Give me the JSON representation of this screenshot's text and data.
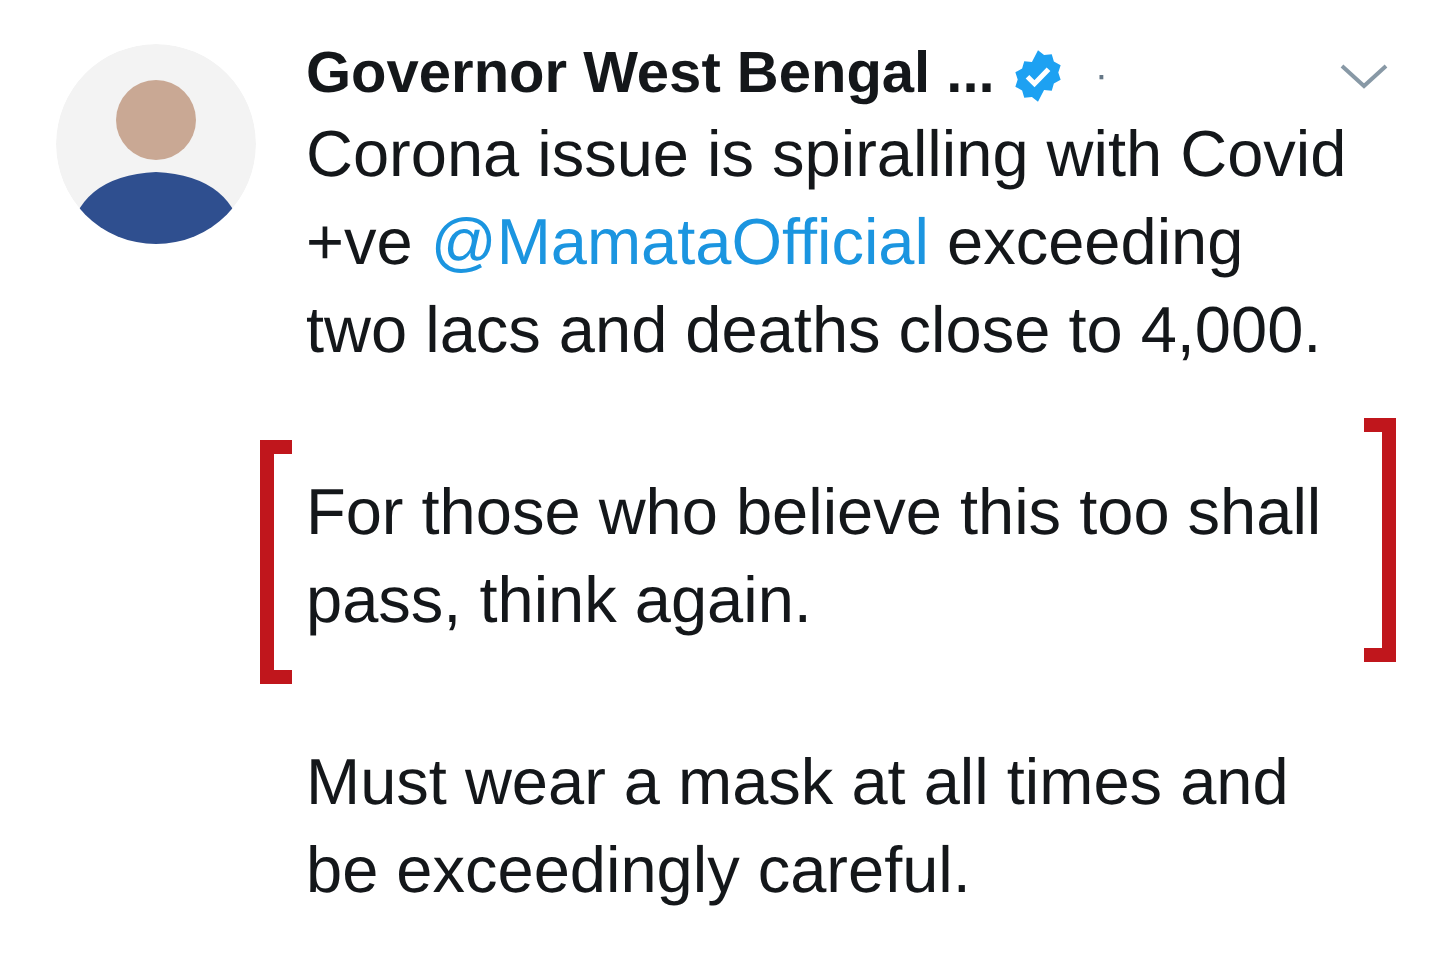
{
  "tweet": {
    "author": {
      "name": "Governor West Bengal ...",
      "verified": true,
      "separator": "·"
    },
    "paragraphs": [
      {
        "highlighted": false,
        "parts": [
          {
            "kind": "text",
            "text": "Corona issue is spiralling with Covid +ve "
          },
          {
            "kind": "mention",
            "text": "@MamataOfficial"
          },
          {
            "kind": "text",
            "text": " exceeding two lacs and deaths close to 4,000."
          }
        ]
      },
      {
        "highlighted": true,
        "parts": [
          {
            "kind": "text",
            "text": "For those who believe this too shall pass, think again."
          }
        ]
      },
      {
        "highlighted": false,
        "parts": [
          {
            "kind": "text",
            "text": "Must wear a mask at all times and be exceedingly careful."
          }
        ]
      }
    ]
  }
}
